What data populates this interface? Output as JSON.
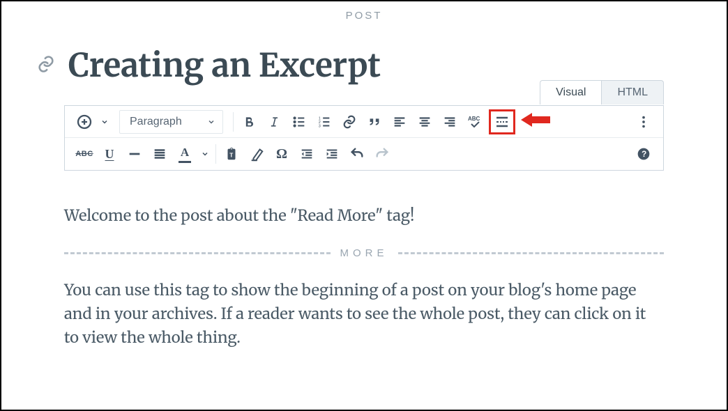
{
  "header": {
    "label": "POST"
  },
  "title": "Creating an Excerpt",
  "tabs": {
    "visual": "Visual",
    "html": "HTML"
  },
  "toolbar": {
    "format_select": "Paragraph"
  },
  "content": {
    "para1": "Welcome to the post about the \"Read More\" tag!",
    "more_label": "MORE",
    "para2": "You can use this tag to show the beginning of a post on your blog's home page and in your archives. If a reader wants to see the whole post, they can click on it to view the whole thing."
  }
}
